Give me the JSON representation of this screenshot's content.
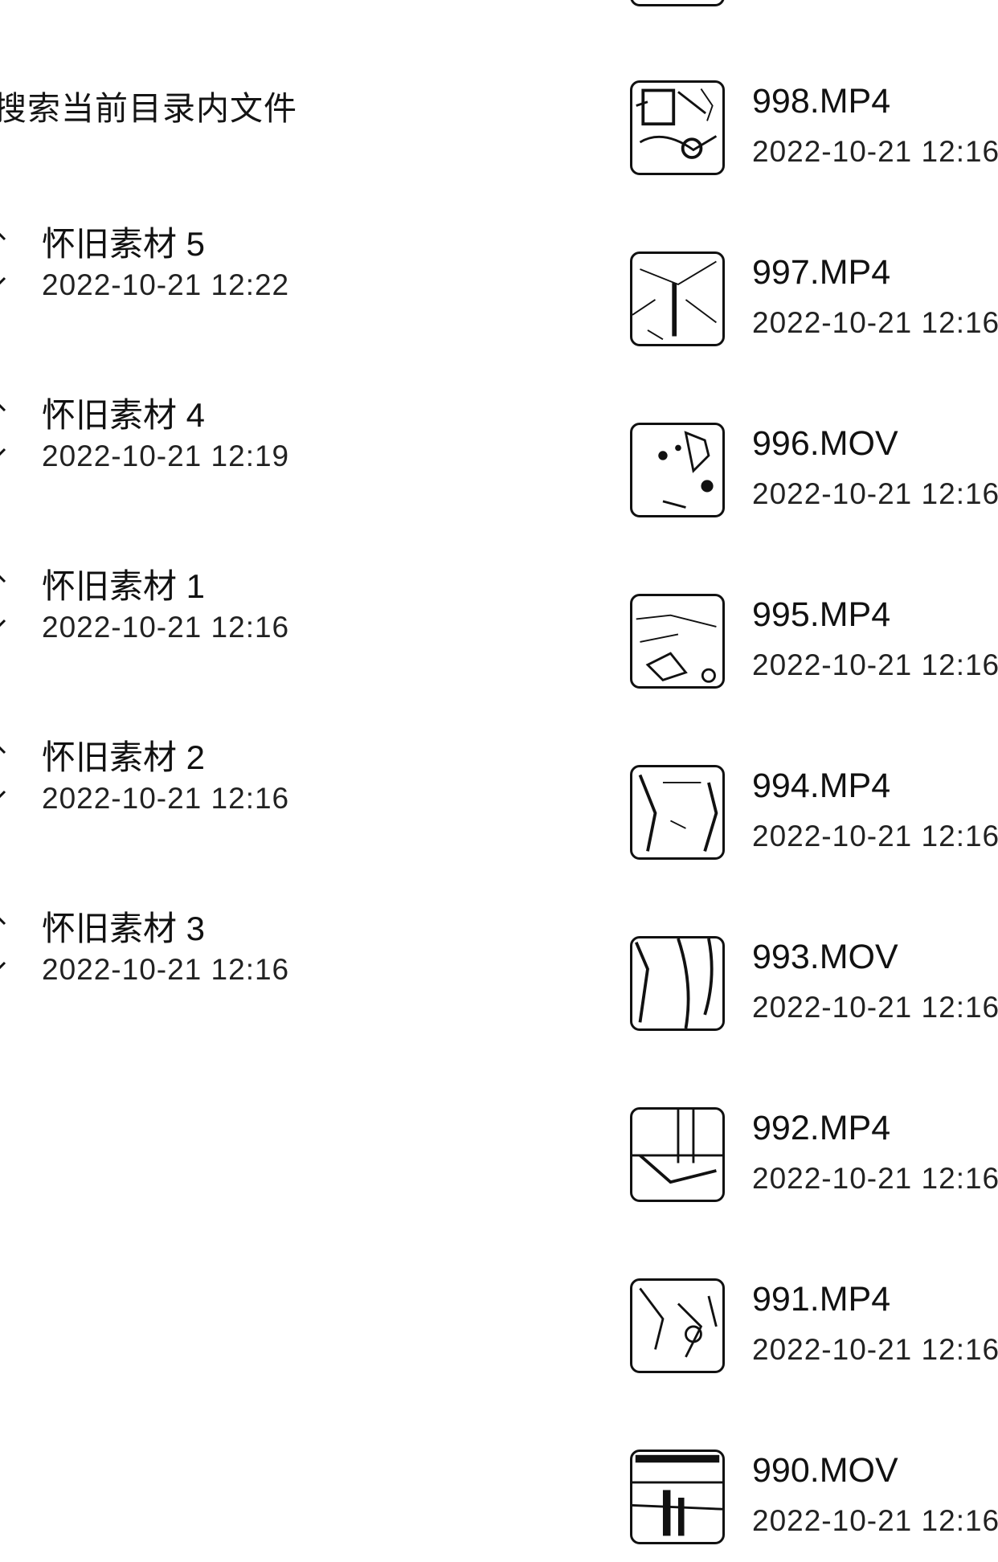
{
  "search": {
    "placeholder": "搜索当前目录内文件"
  },
  "folders": [
    {
      "name": "怀旧素材 5",
      "date": "2022-10-21 12:22"
    },
    {
      "name": "怀旧素材 4",
      "date": "2022-10-21 12:19"
    },
    {
      "name": "怀旧素材 1",
      "date": "2022-10-21 12:16"
    },
    {
      "name": "怀旧素材 2",
      "date": "2022-10-21 12:16"
    },
    {
      "name": "怀旧素材 3",
      "date": "2022-10-21 12:16"
    }
  ],
  "media": [
    {
      "name": "998.MP4",
      "date": "2022-10-21 12:16"
    },
    {
      "name": "997.MP4",
      "date": "2022-10-21 12:16"
    },
    {
      "name": "996.MOV",
      "date": "2022-10-21 12:16"
    },
    {
      "name": "995.MP4",
      "date": "2022-10-21 12:16"
    },
    {
      "name": "994.MP4",
      "date": "2022-10-21 12:16"
    },
    {
      "name": "993.MOV",
      "date": "2022-10-21 12:16"
    },
    {
      "name": "992.MP4",
      "date": "2022-10-21 12:16"
    },
    {
      "name": "991.MP4",
      "date": "2022-10-21 12:16"
    },
    {
      "name": "990.MOV",
      "date": "2022-10-21 12:16"
    }
  ]
}
